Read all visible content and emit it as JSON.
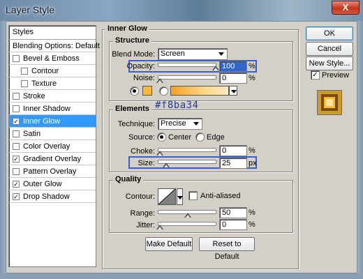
{
  "window": {
    "title": "Layer Style",
    "close_glyph": "X"
  },
  "styles": {
    "header": "Styles",
    "blending_options": "Blending Options: Default",
    "items": [
      {
        "label": "Bevel & Emboss",
        "checked": false,
        "sub": false
      },
      {
        "label": "Contour",
        "checked": false,
        "sub": true
      },
      {
        "label": "Texture",
        "checked": false,
        "sub": true
      },
      {
        "label": "Stroke",
        "checked": false,
        "sub": false
      },
      {
        "label": "Inner Shadow",
        "checked": false,
        "sub": false
      },
      {
        "label": "Inner Glow",
        "checked": true,
        "sub": false,
        "selected": true
      },
      {
        "label": "Satin",
        "checked": false,
        "sub": false
      },
      {
        "label": "Color Overlay",
        "checked": false,
        "sub": false
      },
      {
        "label": "Gradient Overlay",
        "checked": true,
        "sub": false
      },
      {
        "label": "Pattern Overlay",
        "checked": false,
        "sub": false
      },
      {
        "label": "Outer Glow",
        "checked": true,
        "sub": false
      },
      {
        "label": "Drop Shadow",
        "checked": true,
        "sub": false
      }
    ]
  },
  "inner_glow": {
    "title": "Inner Glow",
    "structure": {
      "title": "Structure",
      "blend_mode_label": "Blend Mode:",
      "blend_mode_value": "Screen",
      "opacity_label": "Opacity:",
      "opacity_value": "100",
      "opacity_unit": "%",
      "opacity_level": 1.0,
      "noise_label": "Noise:",
      "noise_value": "0",
      "noise_unit": "%",
      "noise_level": 0.0,
      "glow_color": "#f8ba34",
      "color_mode": "solid"
    },
    "annotation": "#f8ba34",
    "elements": {
      "title": "Elements",
      "technique_label": "Technique:",
      "technique_value": "Precise",
      "source_label": "Source:",
      "source_center": "Center",
      "source_edge": "Edge",
      "source_selected": "Center",
      "choke_label": "Choke:",
      "choke_value": "0",
      "choke_unit": "%",
      "choke_level": 0.0,
      "size_label": "Size:",
      "size_value": "25",
      "size_unit": "px",
      "size_level": 0.1
    },
    "quality": {
      "title": "Quality",
      "contour_label": "Contour:",
      "anti_aliased_label": "Anti-aliased",
      "anti_aliased": false,
      "range_label": "Range:",
      "range_value": "50",
      "range_unit": "%",
      "range_level": 0.5,
      "jitter_label": "Jitter:",
      "jitter_value": "0",
      "jitter_unit": "%",
      "jitter_level": 0.0
    },
    "make_default": "Make Default",
    "reset_default": "Reset to Default"
  },
  "buttons": {
    "ok": "OK",
    "cancel": "Cancel",
    "new_style": "New Style...",
    "preview_label": "Preview",
    "preview_checked": true
  },
  "colors": {
    "selection": "#3399ff",
    "highlight_box": "#3a5fd0",
    "annotation_text": "#2a3a9a",
    "glow": "#f8ba34"
  }
}
